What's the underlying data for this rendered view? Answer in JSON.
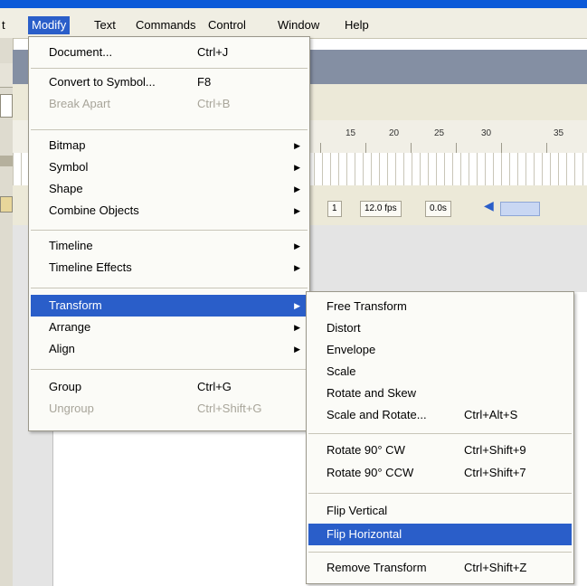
{
  "menubar": {
    "items": [
      {
        "label": "t"
      },
      {
        "label": "Modify"
      },
      {
        "label": "Text"
      },
      {
        "label": "Commands"
      },
      {
        "label": "Control"
      },
      {
        "label": "Window"
      },
      {
        "label": "Help"
      }
    ]
  },
  "background": {
    "ruler_numbers": [
      "15",
      "20",
      "25",
      "30",
      "35"
    ],
    "timeline_status": {
      "frame": "1",
      "fps": "12.0 fps",
      "time": "0.0s"
    }
  },
  "modify_menu": {
    "items": [
      {
        "label": "Document...",
        "shortcut": "Ctrl+J"
      },
      {
        "label": "Convert to Symbol...",
        "shortcut": "F8"
      },
      {
        "label": "Break Apart",
        "shortcut": "Ctrl+B",
        "disabled": true
      },
      {
        "label": "Bitmap",
        "submenu": true
      },
      {
        "label": "Symbol",
        "submenu": true
      },
      {
        "label": "Shape",
        "submenu": true
      },
      {
        "label": "Combine Objects",
        "submenu": true
      },
      {
        "label": "Timeline",
        "submenu": true
      },
      {
        "label": "Timeline Effects",
        "submenu": true
      },
      {
        "label": "Transform",
        "submenu": true,
        "highlighted": true
      },
      {
        "label": "Arrange",
        "submenu": true
      },
      {
        "label": "Align",
        "submenu": true
      },
      {
        "label": "Group",
        "shortcut": "Ctrl+G"
      },
      {
        "label": "Ungroup",
        "shortcut": "Ctrl+Shift+G",
        "disabled": true
      }
    ]
  },
  "transform_menu": {
    "items": [
      {
        "label": "Free Transform"
      },
      {
        "label": "Distort"
      },
      {
        "label": "Envelope"
      },
      {
        "label": "Scale"
      },
      {
        "label": "Rotate and Skew"
      },
      {
        "label": "Scale and Rotate...",
        "shortcut": "Ctrl+Alt+S"
      },
      {
        "label": "Rotate 90° CW",
        "shortcut": "Ctrl+Shift+9"
      },
      {
        "label": "Rotate 90° CCW",
        "shortcut": "Ctrl+Shift+7"
      },
      {
        "label": "Flip Vertical"
      },
      {
        "label": "Flip Horizontal",
        "highlighted": true
      },
      {
        "label": "Remove Transform",
        "shortcut": "Ctrl+Shift+Z"
      }
    ]
  },
  "colors": {
    "highlight": "#2a5ec9",
    "title_bar": "#0c5ad8",
    "menu_bg": "#fbfbf7"
  }
}
